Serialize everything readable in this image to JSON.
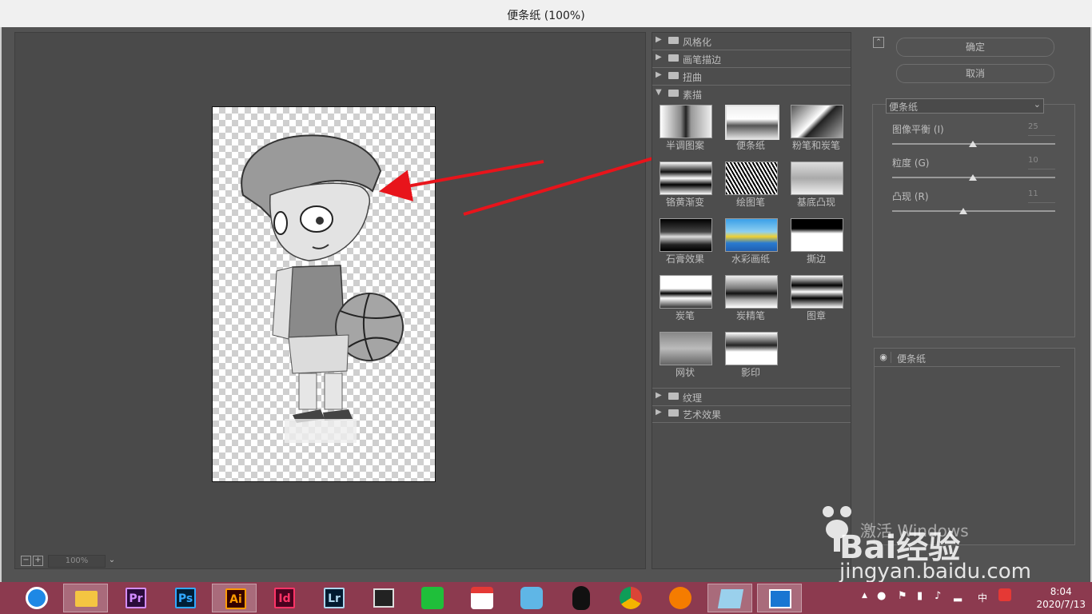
{
  "window": {
    "title": "便条纸 (100%)"
  },
  "preview": {
    "zoom": "100%",
    "zoom_out": "−",
    "zoom_in": "+"
  },
  "gallery": {
    "categories_top": [
      "风格化",
      "画笔描边",
      "扭曲"
    ],
    "open_category": "素描",
    "filters": [
      "半调图案",
      "便条纸",
      "粉笔和炭笔",
      "铬黄渐变",
      "绘图笔",
      "基底凸现",
      "石膏效果",
      "水彩画纸",
      "撕边",
      "炭笔",
      "炭精笔",
      "图章",
      "网状",
      "影印"
    ],
    "categories_bottom": [
      "纹理",
      "艺术效果"
    ]
  },
  "right_panel": {
    "ok_label": "确定",
    "cancel_label": "取消",
    "filter_select": "便条纸",
    "params": [
      {
        "label": "图像平衡 (I)",
        "value": "25",
        "level": 0.5
      },
      {
        "label": "粒度 (G)",
        "value": "10",
        "level": 0.5
      },
      {
        "label": "凸现 (R)",
        "value": "11",
        "level": 0.4
      }
    ],
    "layer_name": "便条纸"
  },
  "taskbar": {
    "apps": [
      "Pr",
      "Ps",
      "Ai",
      "Id",
      "Lr"
    ],
    "active_app": "Ai",
    "ime": "中",
    "time": "8:04",
    "date": "2020/7/13"
  },
  "watermark": {
    "activate": "激活 Windows",
    "brand": "Bai经验",
    "url": "jingyan.baidu.com"
  },
  "colors": {
    "accent_arrow": "#e8141b",
    "taskbar": "#8c3a4f",
    "panel": "#535353"
  }
}
